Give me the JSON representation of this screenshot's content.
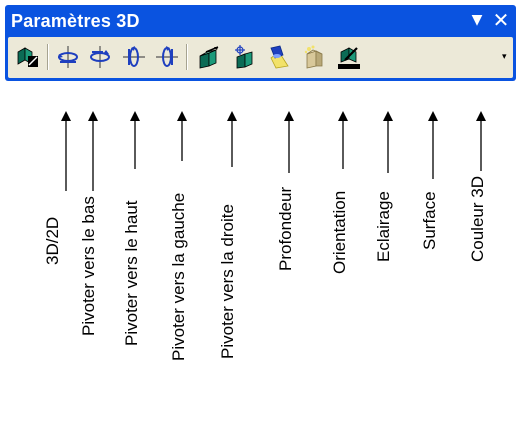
{
  "toolbar": {
    "title": "Paramètres 3D",
    "menu_arrow": "▼",
    "close": "✕",
    "dropdown_arrow": "▾"
  },
  "tools": [
    {
      "name": "3d-2d-toggle-button",
      "icon": "3d-toggle-icon",
      "label": "3D/2D"
    },
    {
      "name": "tilt-down-button",
      "icon": "tilt-down-icon",
      "label": "Pivoter vers le bas"
    },
    {
      "name": "tilt-up-button",
      "icon": "tilt-up-icon",
      "label": "Pivoter vers le haut"
    },
    {
      "name": "tilt-left-button",
      "icon": "tilt-left-icon",
      "label": "Pivoter vers la gauche"
    },
    {
      "name": "tilt-right-button",
      "icon": "tilt-right-icon",
      "label": "Pivoter vers la droite"
    },
    {
      "name": "depth-button",
      "icon": "depth-icon",
      "label": "Profondeur"
    },
    {
      "name": "direction-button",
      "icon": "direction-icon",
      "label": "Orientation"
    },
    {
      "name": "lighting-button",
      "icon": "lighting-icon",
      "label": "Eclairage"
    },
    {
      "name": "surface-button",
      "icon": "surface-icon",
      "label": "Surface"
    },
    {
      "name": "3d-color-button",
      "icon": "3d-color-icon",
      "label": "Couleur 3D"
    }
  ],
  "colors": {
    "titlebar": "#0a53e0",
    "toolbar_bg": "#ece9d8",
    "icon_blue": "#1e3fbf",
    "icon_green": "#0a7a5a",
    "light_yellow": "#f2e26a"
  }
}
